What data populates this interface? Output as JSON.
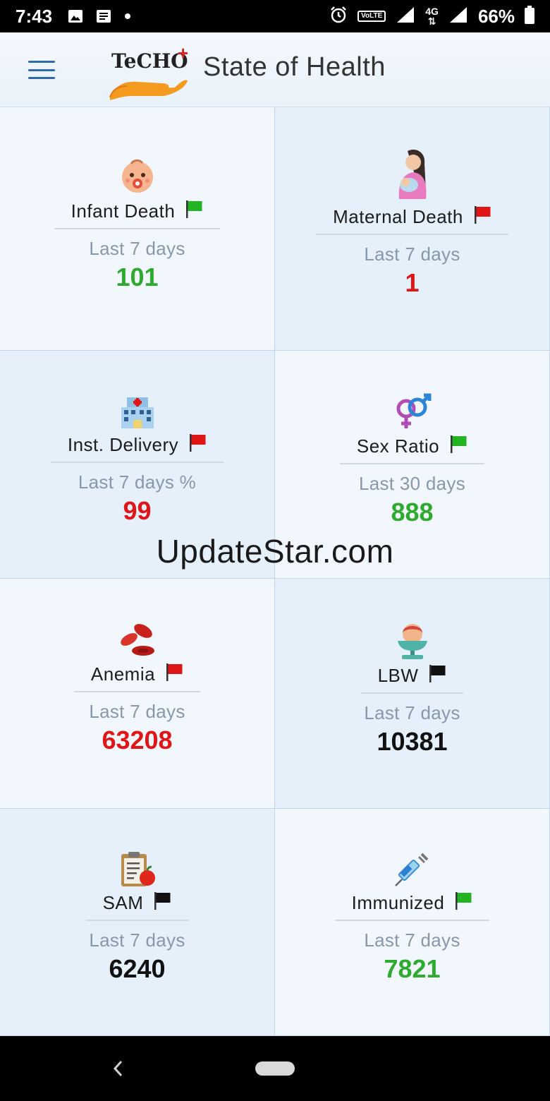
{
  "status_bar": {
    "time": "7:43",
    "battery": "66%",
    "volte": "VoLTE",
    "network": "4G",
    "icons": [
      "image-icon",
      "message-icon",
      "dot-icon",
      "alarm-icon",
      "volte-icon",
      "signal-icon",
      "network-4g-icon",
      "signal-icon",
      "battery-icon"
    ]
  },
  "header": {
    "menu_icon": "menu-icon",
    "logo_text": "TeCHO",
    "logo_plus": "+",
    "title": "State of Health"
  },
  "tiles": [
    {
      "title": "Infant Death",
      "icon": "baby-face-icon",
      "flag": "green",
      "period": "Last 7 days",
      "value": "101",
      "value_color": "green"
    },
    {
      "title": "Maternal Death",
      "icon": "mother-baby-icon",
      "flag": "red",
      "period": "Last 7 days",
      "value": "1",
      "value_color": "red"
    },
    {
      "title": "Inst. Delivery",
      "icon": "hospital-icon",
      "flag": "red",
      "period": "Last 7 days %",
      "value": "99",
      "value_color": "red"
    },
    {
      "title": "Sex Ratio",
      "icon": "gender-icon",
      "flag": "green",
      "period": "Last 30 days",
      "value": "888",
      "value_color": "green"
    },
    {
      "title": "Anemia",
      "icon": "blood-cells-icon",
      "flag": "red",
      "period": "Last 7 days",
      "value": "63208",
      "value_color": "red"
    },
    {
      "title": "LBW",
      "icon": "baby-scale-icon",
      "flag": "black",
      "period": "Last 7 days",
      "value": "10381",
      "value_color": "black"
    },
    {
      "title": "SAM",
      "icon": "clipboard-apple-icon",
      "flag": "black",
      "period": "Last 7 days",
      "value": "6240",
      "value_color": "black"
    },
    {
      "title": "Immunized",
      "icon": "syringe-icon",
      "flag": "green",
      "period": "Last 7 days",
      "value": "7821",
      "value_color": "green"
    }
  ],
  "watermark": "UpdateStar.com",
  "colors": {
    "green": "#2eaa2e",
    "red": "#e01616",
    "black": "#111111",
    "flag_green": "#22b422",
    "flag_red": "#e01616",
    "flag_black": "#111111"
  }
}
